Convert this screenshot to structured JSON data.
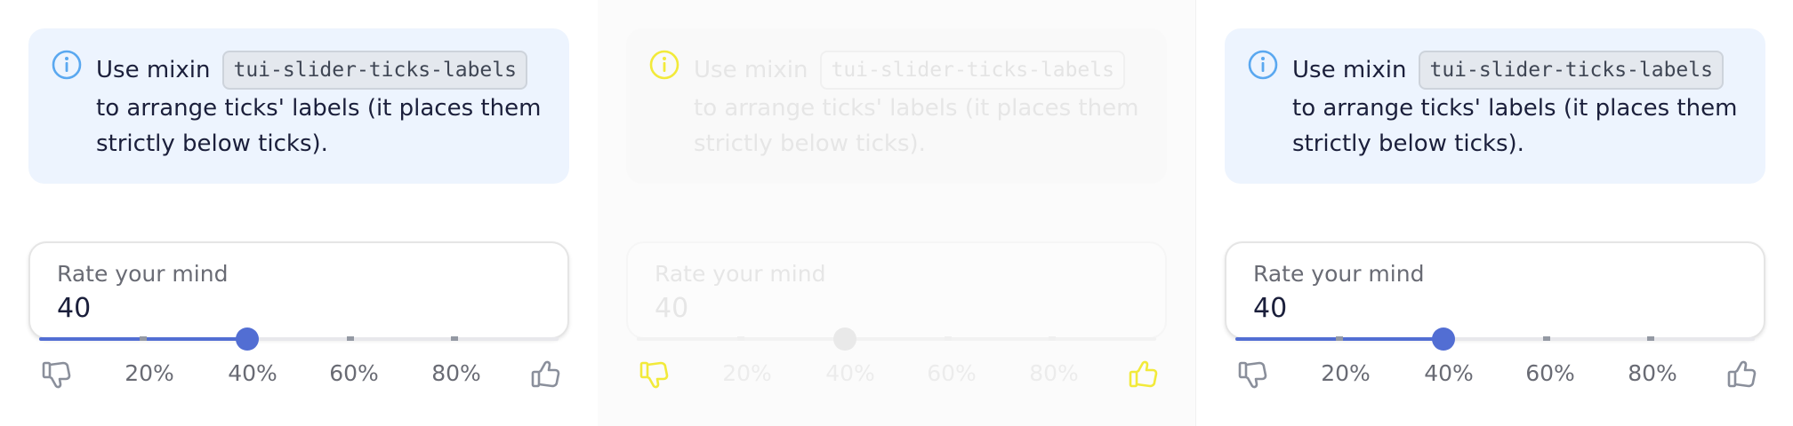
{
  "panels": [
    {
      "state": "normal",
      "notice": {
        "lead": "Use mixin",
        "code": "tui-slider-ticks-labels",
        "line2": "to arrange ticks' labels (it places them",
        "line3": "strictly below ticks)."
      },
      "field": {
        "label": "Rate your mind",
        "value": "40"
      },
      "slider": {
        "value_percent": 40
      },
      "tick_labels": [
        "20%",
        "40%",
        "60%",
        "80%"
      ]
    },
    {
      "state": "faded",
      "notice": {
        "lead": "Use mixin",
        "code": "tui-slider-ticks-labels",
        "line2": "to arrange ticks' labels (it places them",
        "line3": "strictly below ticks)."
      },
      "field": {
        "label": "Rate your mind",
        "value": "40"
      },
      "slider": {
        "value_percent": 40
      },
      "tick_labels": [
        "20%",
        "40%",
        "60%",
        "80%"
      ]
    },
    {
      "state": "normal",
      "notice": {
        "lead": "Use mixin",
        "code": "tui-slider-ticks-labels",
        "line2": "to arrange ticks' labels (it places them",
        "line3": "strictly below ticks)."
      },
      "field": {
        "label": "Rate your mind",
        "value": "40"
      },
      "slider": {
        "value_percent": 40
      },
      "tick_labels": [
        "20%",
        "40%",
        "60%",
        "80%"
      ]
    }
  ],
  "icons": {
    "info": "info-circle-icon",
    "dislike": "thumbs-down-icon",
    "like": "thumbs-up-icon"
  },
  "colors": {
    "accent": "#526ed3",
    "info_blue": "#5aa8f0",
    "notice_bg": "#edf4fe",
    "icon_gray": "#8a8f9b",
    "faded_icon_yellow": "#f2ea3a"
  }
}
